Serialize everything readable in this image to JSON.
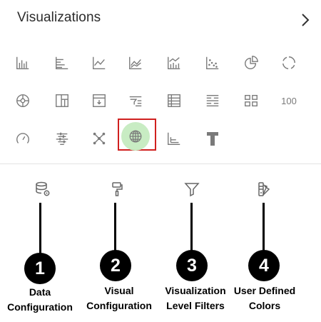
{
  "panel": {
    "title": "Visualizations",
    "expand_icon": "chevron-right-icon"
  },
  "viz_rows": [
    [
      "bar-chart-icon",
      "horizontal-bar-icon",
      "line-chart-icon",
      "area-chart-icon",
      "combo-bar-line-icon",
      "scatter-icon",
      "pie-chart-icon",
      "donut-chart-icon"
    ],
    [
      "sunburst-icon",
      "treemap-icon",
      "pivot-table-icon",
      "funnel-filter-icon",
      "table-icon",
      "list-icon",
      "tile-grid-icon",
      "number-tile"
    ],
    [
      "gauge-icon",
      "timeline-icon",
      "network-graph-icon",
      "map-globe-icon",
      "correlation-icon",
      "text-icon"
    ]
  ],
  "number_tile_text": "100",
  "selected_visualization": "map-globe-icon",
  "annotation_colors": {
    "highlight_border": "#d0201f",
    "highlight_fill": "#c8ecc3",
    "marker": "#000000"
  },
  "tools": [
    {
      "name": "data-configuration-icon",
      "number": "1",
      "label_lines": [
        "Data",
        "Configuration"
      ]
    },
    {
      "name": "visual-configuration-icon",
      "number": "2",
      "label_lines": [
        "Visual",
        "Configuration"
      ]
    },
    {
      "name": "visualization-level-filters-icon",
      "number": "3",
      "label_lines": [
        "Visualization",
        "Level Filters"
      ]
    },
    {
      "name": "user-defined-colors-icon",
      "number": "4",
      "label_lines": [
        "User Defined",
        "Colors"
      ]
    }
  ]
}
